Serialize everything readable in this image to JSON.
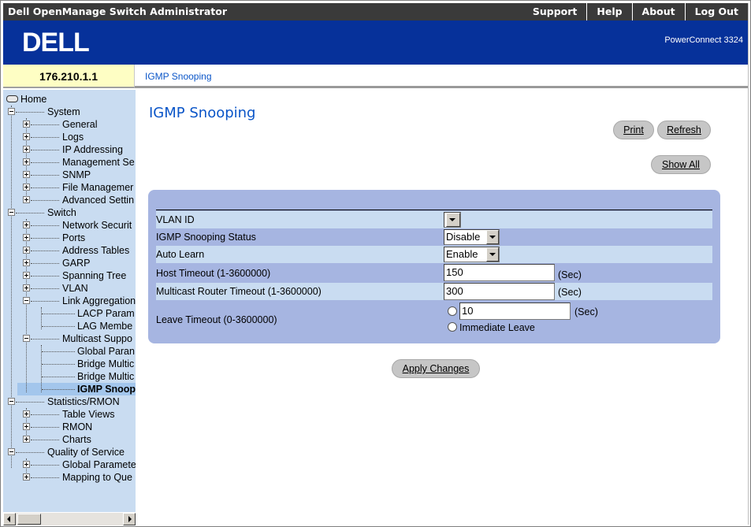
{
  "titlebar": {
    "app_title": "Dell OpenManage Switch Administrator",
    "links": [
      "Support",
      "Help",
      "About",
      "Log Out"
    ]
  },
  "brand": {
    "logo_text": "DELL",
    "model": "PowerConnect 3324",
    "bar_color": "#06319a"
  },
  "ip_address": "176.210.1.1",
  "breadcrumb": "IGMP Snooping",
  "tree": {
    "home": "Home",
    "system": {
      "label": "System",
      "children": [
        "General",
        "Logs",
        "IP Addressing",
        "Management Se",
        "SNMP",
        "File Managemer",
        "Advanced Settin"
      ]
    },
    "switch": {
      "label": "Switch",
      "children": [
        "Network Securit",
        "Ports",
        "Address Tables",
        "GARP",
        "Spanning Tree",
        "VLAN",
        "Link Aggregation"
      ],
      "link_aggregation_children": [
        "LACP Param",
        "LAG Membe"
      ],
      "multicast": "Multicast Suppo",
      "multicast_children": [
        "Global Paran",
        "Bridge Multic",
        "Bridge Multic",
        "IGMP Snoop"
      ]
    },
    "statistics": {
      "label": "Statistics/RMON",
      "children": [
        "Table Views",
        "RMON",
        "Charts"
      ]
    },
    "qos": {
      "label": "Quality of Service",
      "children": [
        "Global Paramete",
        "Mapping to Que"
      ]
    }
  },
  "main": {
    "title": "IGMP Snooping",
    "buttons": {
      "print": "Print",
      "refresh": "Refresh",
      "show_all": "Show All",
      "apply": "Apply Changes"
    },
    "form": {
      "vlan_id_label": "VLAN ID",
      "vlan_id_value": "",
      "status_label": "IGMP Snooping Status",
      "status_value": "Disable",
      "auto_learn_label": "Auto Learn",
      "auto_learn_value": "Enable",
      "host_timeout_label": "Host Timeout (1-3600000)",
      "host_timeout_value": "150",
      "mrouter_timeout_label": "Multicast Router Timeout (1-3600000)",
      "mrouter_timeout_value": "300",
      "leave_timeout_label": "Leave Timeout (0-3600000)",
      "leave_timeout_value": "10",
      "immediate_leave_label": "Immediate Leave",
      "sec_unit": "(Sec)"
    }
  }
}
